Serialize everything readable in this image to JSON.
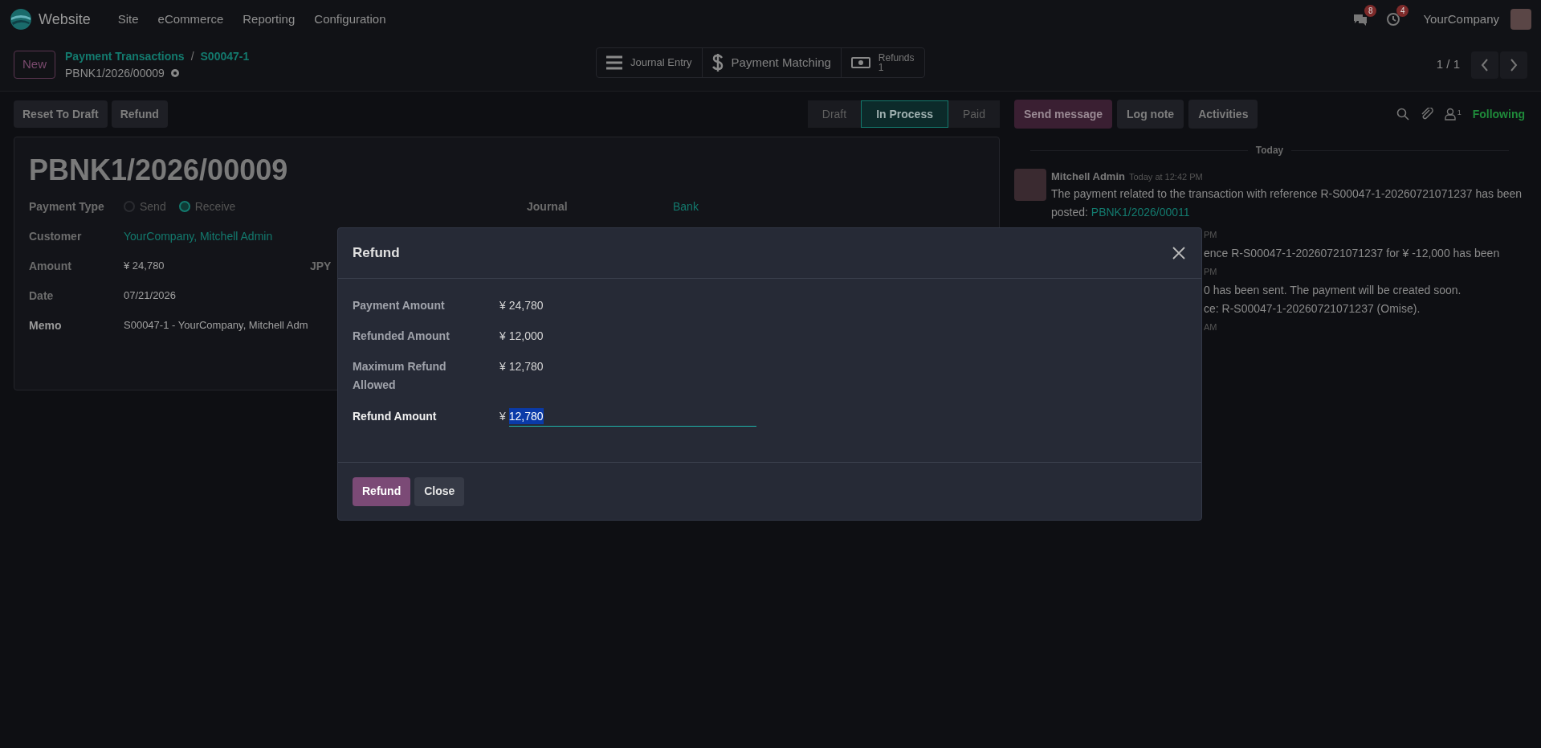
{
  "navbar": {
    "app_name": "Website",
    "menu": [
      "Site",
      "eCommerce",
      "Reporting",
      "Configuration"
    ],
    "messages_badge": "8",
    "activities_badge": "4",
    "company": "YourCompany"
  },
  "control_panel": {
    "new_button": "New",
    "breadcrumbs": [
      "Payment Transactions",
      "S00047-1"
    ],
    "breadcrumb_separator": "/",
    "record_name": "PBNK1/2026/00009",
    "smart_buttons": [
      {
        "kind": "list",
        "label": "Journal Entry"
      },
      {
        "kind": "dollar",
        "label": "Payment Matching"
      },
      {
        "kind": "money",
        "label": "Refunds",
        "count": "1"
      }
    ],
    "pager": "1 / 1"
  },
  "action_buttons": [
    "Reset To Draft",
    "Refund"
  ],
  "status_steps": [
    {
      "label": "Draft",
      "selected": false
    },
    {
      "label": "In Process",
      "selected": true
    },
    {
      "label": "Paid",
      "selected": false
    }
  ],
  "form": {
    "title": "PBNK1/2026/00009",
    "payment_type": {
      "label": "Payment Type",
      "options": [
        {
          "label": "Send",
          "selected": false
        },
        {
          "label": "Receive",
          "selected": true
        }
      ]
    },
    "journal": {
      "label": "Journal",
      "value": "Bank"
    },
    "fields": [
      {
        "label": "Customer",
        "value": "YourCompany, Mitchell Admin",
        "kind": "link",
        "required": false
      },
      {
        "label": "Amount",
        "value": "¥ 24,780",
        "currency": "JPY",
        "kind": "text",
        "required": false
      },
      {
        "label": "Date",
        "value": "07/21/2026",
        "kind": "text",
        "required": false
      },
      {
        "label": "Memo",
        "value": "S00047-1 - YourCompany, Mitchell Adm",
        "kind": "text",
        "required": true
      }
    ]
  },
  "chatter": {
    "buttons": [
      {
        "label": "Send message",
        "selected": true
      },
      {
        "label": "Log note",
        "selected": false
      },
      {
        "label": "Activities",
        "selected": false
      }
    ],
    "followers_count": "1",
    "follow_label": "Following",
    "date_separator": "Today",
    "message": {
      "author": "Mitchell Admin",
      "time": "Today at 12:42 PM",
      "text": "The payment related to the transaction with reference R-S00047-1-20260721071237 has been posted: ",
      "link": "PBNK1/2026/00011"
    },
    "fragments": [
      {
        "kind": "time",
        "text": "PM"
      },
      {
        "kind": "body",
        "text": "ence R-S00047-1-20260721071237 for ¥ -12,000 has been"
      },
      {
        "kind": "time",
        "text": "PM"
      },
      {
        "kind": "body",
        "text": "0 has been sent. The payment will be created soon."
      },
      {
        "kind": "body",
        "text": "ce: R-S00047-1-20260721071237 (Omise)."
      },
      {
        "kind": "time",
        "text": "AM"
      }
    ]
  },
  "dialog": {
    "title": "Refund",
    "rows": [
      {
        "label": "Payment Amount",
        "value": "¥ 24,780"
      },
      {
        "label": "Refunded Amount",
        "value": "¥ 12,000"
      },
      {
        "label": "Maximum Refund Allowed",
        "value": "¥ 12,780"
      }
    ],
    "input": {
      "label": "Refund Amount",
      "currency": "¥",
      "value": "12,780"
    },
    "buttons": [
      {
        "label": "Refund",
        "primary": true
      },
      {
        "label": "Close",
        "primary": false
      }
    ]
  }
}
